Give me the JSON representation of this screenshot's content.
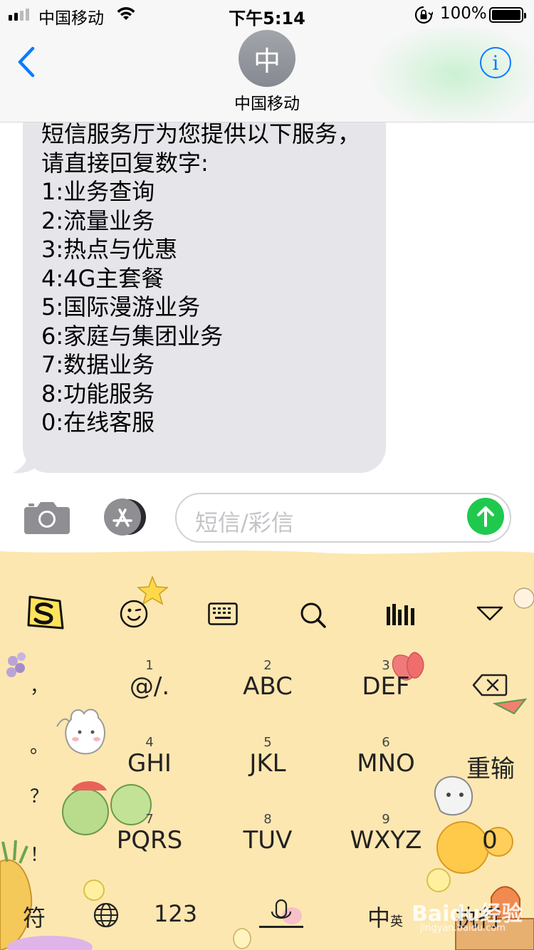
{
  "status_bar": {
    "carrier": "中国移动",
    "time": "下午5:14",
    "battery": "100%"
  },
  "nav": {
    "avatar_initial": "中",
    "contact_name": "中国移动",
    "info_label": "i"
  },
  "message": {
    "lines": [
      "短信服务厅为您提供以下服务，",
      "请直接回复数字:",
      "1:业务查询",
      "2:流量业务",
      "3:热点与优惠",
      "4:4G主套餐",
      "5:国际漫游业务",
      "6:家庭与集团业务",
      "7:数据业务",
      "8:功能服务",
      "0:在线客服"
    ]
  },
  "input": {
    "placeholder": "短信/彩信"
  },
  "keyboard": {
    "toolbar_icons": [
      "sogou-logo",
      "emoji-icon",
      "keyboard-icon",
      "search-icon",
      "handwrite-icon",
      "collapse-icon"
    ],
    "punctuation": [
      "，",
      "。",
      "？",
      "！"
    ],
    "keys": [
      {
        "num": "1",
        "label": "@/."
      },
      {
        "num": "2",
        "label": "ABC"
      },
      {
        "num": "3",
        "label": "DEF"
      },
      {
        "num": "4",
        "label": "GHI"
      },
      {
        "num": "5",
        "label": "JKL"
      },
      {
        "num": "6",
        "label": "MNO"
      },
      {
        "num": "7",
        "label": "PQRS"
      },
      {
        "num": "8",
        "label": "TUV"
      },
      {
        "num": "9",
        "label": "WXYZ"
      }
    ],
    "reinput": "重输",
    "zero": "0",
    "symbol": "符",
    "numbers": "123",
    "zh": "中",
    "en": "英",
    "execute": "执行",
    "watermark": "Baidu经验",
    "watermark_sub": "jingyan.baidu.com"
  },
  "colors": {
    "accent": "#0a7aff",
    "send": "#1fc94e",
    "bubble": "#e5e5ea",
    "keyboard_bg": "#fde7b0"
  }
}
